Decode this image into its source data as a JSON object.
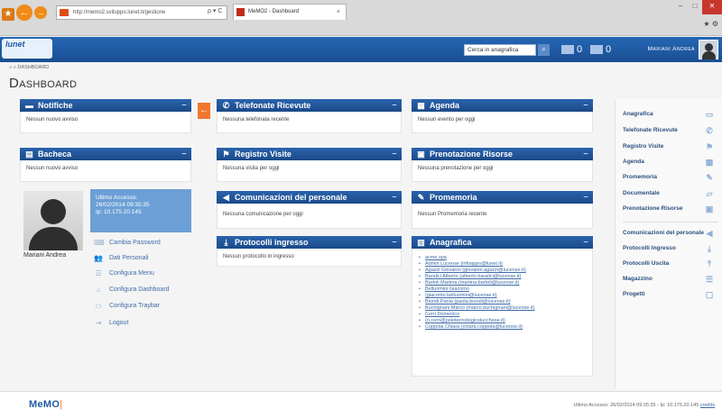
{
  "browser": {
    "address": "http://memo2.sviluppo.lunet.it/gestione",
    "address_tools": "ρ ▾ C",
    "tab_title": "MeMO2 - Dashboard",
    "tab_close": "×",
    "win_min": "–",
    "win_max": "□",
    "win_close": "✕",
    "tools": "★ ⚙"
  },
  "header": {
    "logo_text": "lunet",
    "search_placeholder": "Cerca in anagrafica",
    "search_icon": "search-icon",
    "phone_count": "0",
    "visits_count": "0",
    "user_name": "Mariani Andrea"
  },
  "breadcrumb": "⌂ » Dashboard",
  "page_title": "Dashboard",
  "left": {
    "notifiche": {
      "title": "Notifiche",
      "body": "Nessun nuovo avviso"
    },
    "bacheca": {
      "title": "Bacheca",
      "body": "Nessun nuovo avviso"
    },
    "profile": {
      "name": "Mariani Andrea",
      "last_access_label": "Ultimo Accesso:",
      "last_access_date": "26/02/2014 09:35:35",
      "ip": "Ip: 10.175.20.145"
    },
    "links": [
      {
        "label": "Cambia Password",
        "icon": "keyboard-icon"
      },
      {
        "label": "Dati Personali",
        "icon": "users-icon"
      },
      {
        "label": "Configura Menu",
        "icon": "list-icon"
      },
      {
        "label": "Configura Dashboard",
        "icon": "home-icon"
      },
      {
        "label": "Configura Traybar",
        "icon": "traybar-icon"
      },
      {
        "label": "Logout",
        "icon": "logout-icon"
      }
    ]
  },
  "toggle_icon": "←",
  "middle": {
    "telefonate": {
      "title": "Telefonate Ricevute",
      "body": "Nessuna telefonata recente"
    },
    "visite": {
      "title": "Registro Visite",
      "body": "Nessuna visita per oggi"
    },
    "comunicazioni": {
      "title": "Comunicazioni del personale",
      "body": "Nessuna comunicazione per oggi"
    },
    "protocolli": {
      "title": "Protocolli ingresso",
      "body": "Nessun protocollo in ingresso"
    }
  },
  "right_col": {
    "agenda": {
      "title": "Agenda",
      "body": "Nessun evento per oggi"
    },
    "prenotazione": {
      "title": "Prenotazione Risorse",
      "body": "Nessuna prenotazione per oggi"
    },
    "promemoria": {
      "title": "Promemoria",
      "body": "Nessun Promemoria recente"
    },
    "anagrafica": {
      "title": "Anagrafica",
      "items": [
        "acme spa",
        "Admin Lucense (infoappo@lunet.it)",
        "Agazzi Giovanni (giovanni.agazzi@lucense.it)",
        "Baralici Alberto (alberto.baralici@lucense.it)",
        "Bartoli Martina (martina.bartoli@lucense.it)",
        "Belluomini Giacomo",
        "(giacomo.belluomini@lucense.it)",
        "Biondi Paola (paola.biondi@lucense.it)",
        "Buchignani Marco (marco.buchignani@lucense.it)",
        "Cerri Domenico",
        "(n.cerri@polotecnologicolucchese.it)",
        "Coppola Chiara (chiara.coppola@lucense.it)"
      ]
    }
  },
  "right_menu": {
    "items": [
      {
        "label": "Anagrafica",
        "icon": "address-card-icon"
      },
      {
        "label": "Telefonate Ricevute",
        "icon": "phone-icon"
      },
      {
        "label": "Registro Visite",
        "icon": "visitor-icon"
      },
      {
        "label": "Agenda",
        "icon": "calendar-icon"
      },
      {
        "label": "Promemoria",
        "icon": "pin-icon"
      },
      {
        "label": "Documentale",
        "icon": "folder-icon"
      },
      {
        "label": "Prenotazione Risorse",
        "icon": "booking-icon"
      },
      {
        "label": "Comunicazioni del personale",
        "icon": "megaphone-icon"
      },
      {
        "label": "Protocolli Ingresso",
        "icon": "download-icon"
      },
      {
        "label": "Protocolli Uscita",
        "icon": "upload-icon"
      },
      {
        "label": "Magazzino",
        "icon": "database-icon"
      },
      {
        "label": "Progetti",
        "icon": "clipboard-icon"
      }
    ]
  },
  "footer": {
    "logo": "MeMO",
    "logo_sep": "|",
    "info": "Ultimo Accesso: 26/02/2014 09:35:35 - Ip: 10.175.20.145",
    "credits": "credits"
  },
  "colors": {
    "primary": "#1e5ba5",
    "accent": "#f2762e",
    "link": "#3e6ba8"
  }
}
